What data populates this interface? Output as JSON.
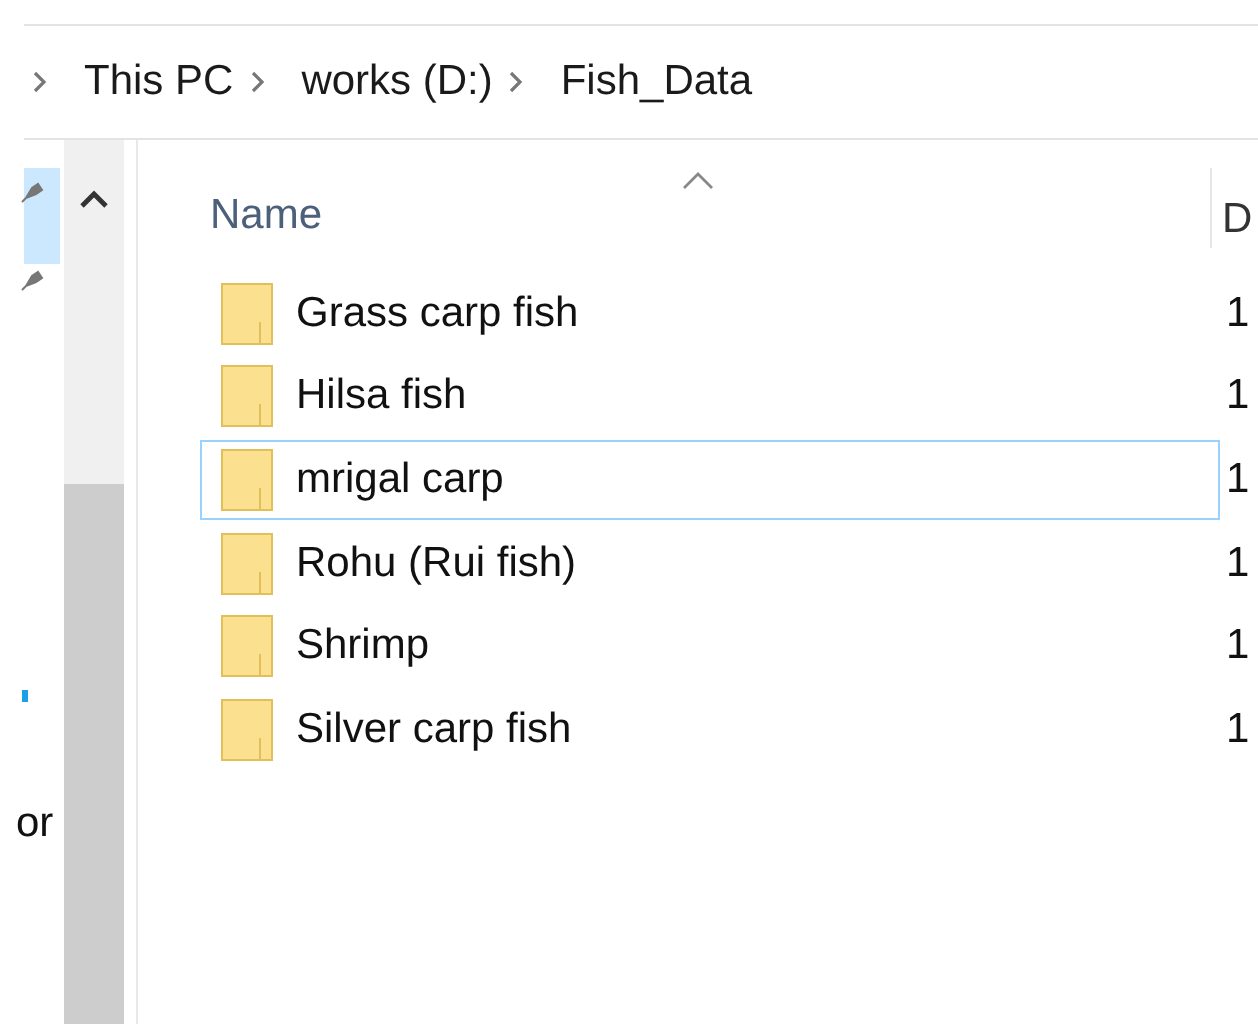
{
  "breadcrumb": [
    "This PC",
    "works (D:)",
    "Fish_Data"
  ],
  "nav_pane": {
    "items": [
      {
        "kind": "pin"
      },
      {
        "kind": "pin"
      },
      {
        "kind": "dot"
      },
      {
        "kind": "text",
        "label": "or"
      }
    ]
  },
  "columns": [
    {
      "label": "Name",
      "sorted": true
    },
    {
      "label": "D",
      "sorted": false
    }
  ],
  "rows": [
    {
      "name": "Grass carp fish",
      "column_2": "1",
      "selected": false
    },
    {
      "name": "Hilsa fish",
      "column_2": "1",
      "selected": false
    },
    {
      "name": "mrigal carp",
      "column_2": "1",
      "selected": true
    },
    {
      "name": "Rohu (Rui fish)",
      "column_2": "1",
      "selected": false
    },
    {
      "name": "Shrimp",
      "column_2": "1",
      "selected": false
    },
    {
      "name": "Silver carp fish",
      "column_2": "1",
      "selected": false
    }
  ]
}
